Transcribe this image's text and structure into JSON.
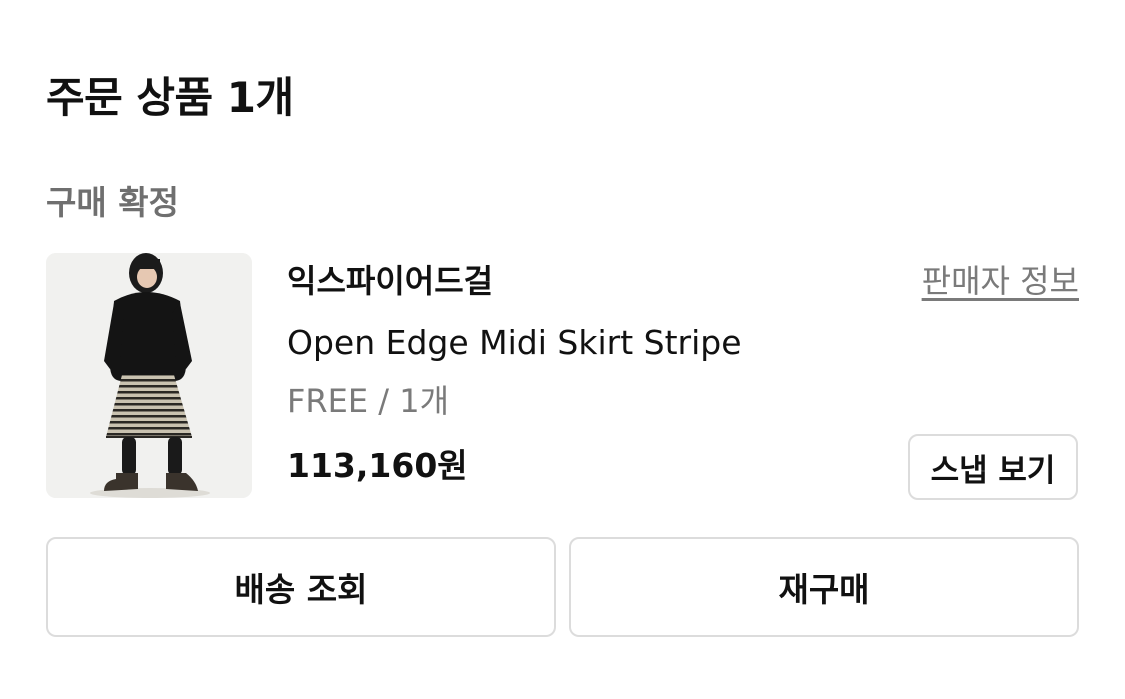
{
  "order_items": {
    "title": "주문 상품 1개",
    "status": "구매 확정"
  },
  "product": {
    "brand": "익스파이어드걸",
    "seller_info_label": "판매자 정보",
    "name": "Open Edge Midi Skirt Stripe",
    "option": "FREE / 1개",
    "price": "113,160원",
    "snap_label": "스냅 보기"
  },
  "actions": {
    "tracking_label": "배송 조회",
    "reorder_label": "재구매"
  },
  "colors": {
    "text_primary": "#111111",
    "text_secondary": "#7a7a7a",
    "border": "#dcdcdc",
    "thumb_bg": "#f1f1ef"
  }
}
